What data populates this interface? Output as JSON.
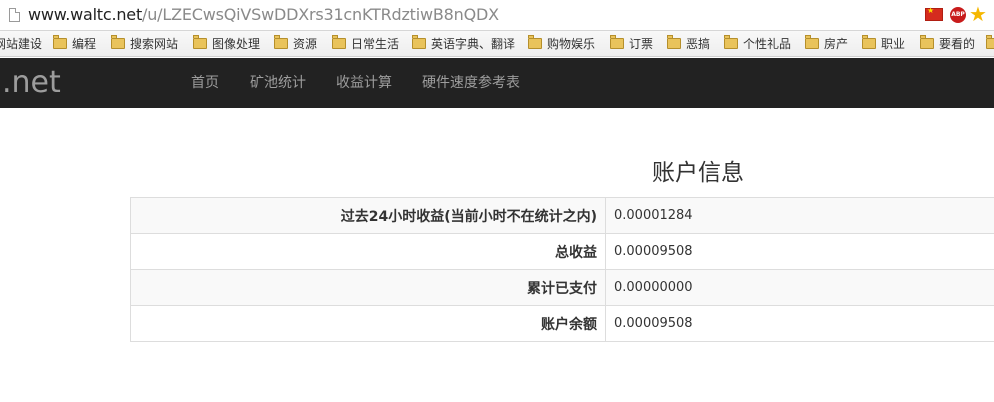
{
  "browser": {
    "url_host": "www.waltc.net",
    "url_path": "/u/LZECwsQiVSwDDXrs31cnKTRdztiwB8nQDX",
    "abp_label": "ABP",
    "icons": [
      "page-icon",
      "china-flag-icon",
      "adblock-plus-icon",
      "bookmark-star-icon"
    ]
  },
  "bookmarks": [
    {
      "label": "网站建设",
      "folder": false
    },
    {
      "label": "编程",
      "folder": true
    },
    {
      "label": "搜索网站",
      "folder": true
    },
    {
      "label": "图像处理",
      "folder": true
    },
    {
      "label": "资源",
      "folder": true
    },
    {
      "label": "日常生活",
      "folder": true
    },
    {
      "label": "英语字典、翻译",
      "folder": true
    },
    {
      "label": "购物娱乐",
      "folder": true
    },
    {
      "label": "订票",
      "folder": true
    },
    {
      "label": "恶搞",
      "folder": true
    },
    {
      "label": "个性礼品",
      "folder": true
    },
    {
      "label": "房产",
      "folder": true
    },
    {
      "label": "职业",
      "folder": true
    },
    {
      "label": "要看的",
      "folder": true
    },
    {
      "label": "",
      "folder": true
    }
  ],
  "navbar": {
    "brand": ".net",
    "items": [
      "首页",
      "矿池统计",
      "收益计算",
      "硬件速度参考表"
    ]
  },
  "account": {
    "title": "账户信息",
    "rows": [
      {
        "label": "过去24小时收益(当前小时不在统计之内)",
        "value": "0.00001284"
      },
      {
        "label": "总收益",
        "value": "0.00009508"
      },
      {
        "label": "累计已支付",
        "value": "0.00000000"
      },
      {
        "label": "账户余额",
        "value": "0.00009508"
      }
    ]
  },
  "colors": {
    "navbar_bg": "#222222",
    "nav_text": "#9d9d9d",
    "table_border": "#dddddd",
    "stripe": "#f9f9f9"
  }
}
